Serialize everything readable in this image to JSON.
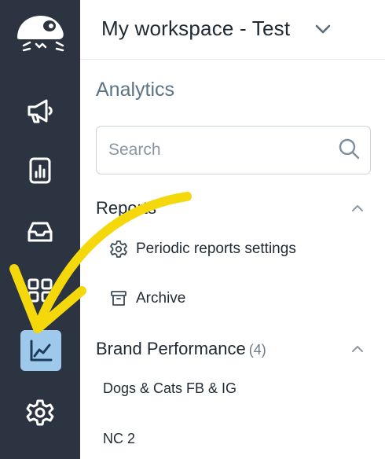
{
  "workspace": {
    "title": "My workspace - Test"
  },
  "nav": {
    "items": [
      {
        "name": "campaigns-icon"
      },
      {
        "name": "reports-icon"
      },
      {
        "name": "inbox-icon"
      },
      {
        "name": "apps-icon"
      },
      {
        "name": "analytics-icon",
        "active": true
      },
      {
        "name": "settings-icon"
      }
    ]
  },
  "analytics": {
    "title": "Analytics",
    "search_placeholder": "Search"
  },
  "reports": {
    "title": "Reports",
    "items": [
      {
        "label": "Periodic reports settings",
        "icon": "gear-icon"
      },
      {
        "label": "Archive",
        "icon": "archive-icon"
      }
    ]
  },
  "brand_performance": {
    "title": "Brand Performance",
    "count": "(4)",
    "items": [
      {
        "label": "Dogs & Cats FB & IG"
      },
      {
        "label": "NC 2"
      }
    ]
  },
  "colors": {
    "rail": "#2b3440",
    "active_item": "#9ec9ea",
    "annotation_arrow": "#f4d80b"
  }
}
